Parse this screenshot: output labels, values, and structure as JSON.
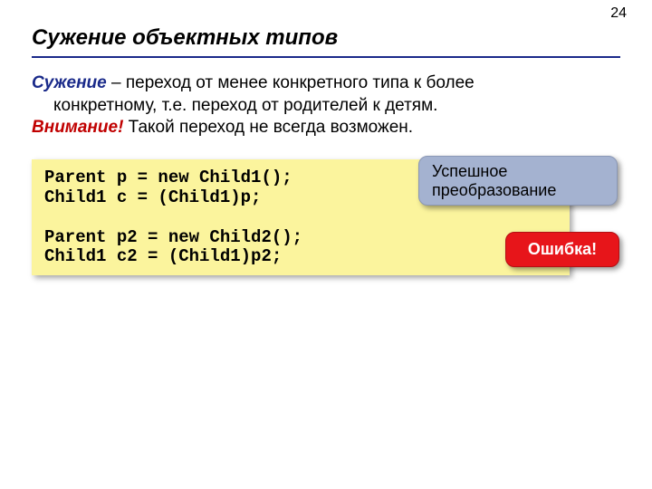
{
  "page_number": "24",
  "title": "Сужение объектных типов",
  "body": {
    "term": "Сужение",
    "line1_rest": " – переход от менее конкретного типа к более",
    "line1_cont": "конкретному, т.е. переход от родителей к детям.",
    "warn_label": "Внимание!",
    "warn_rest": " Такой переход не всегда возможен."
  },
  "code": {
    "l1": "Parent p = new Child1();",
    "l2": "Child1 c = (Child1)p;",
    "l3": "",
    "l4": "Parent p2 = new Child2();",
    "l5": "Child1 c2 = (Child1)p2;"
  },
  "callouts": {
    "success": "Успешное преобразование",
    "error": "Ошибка!"
  }
}
